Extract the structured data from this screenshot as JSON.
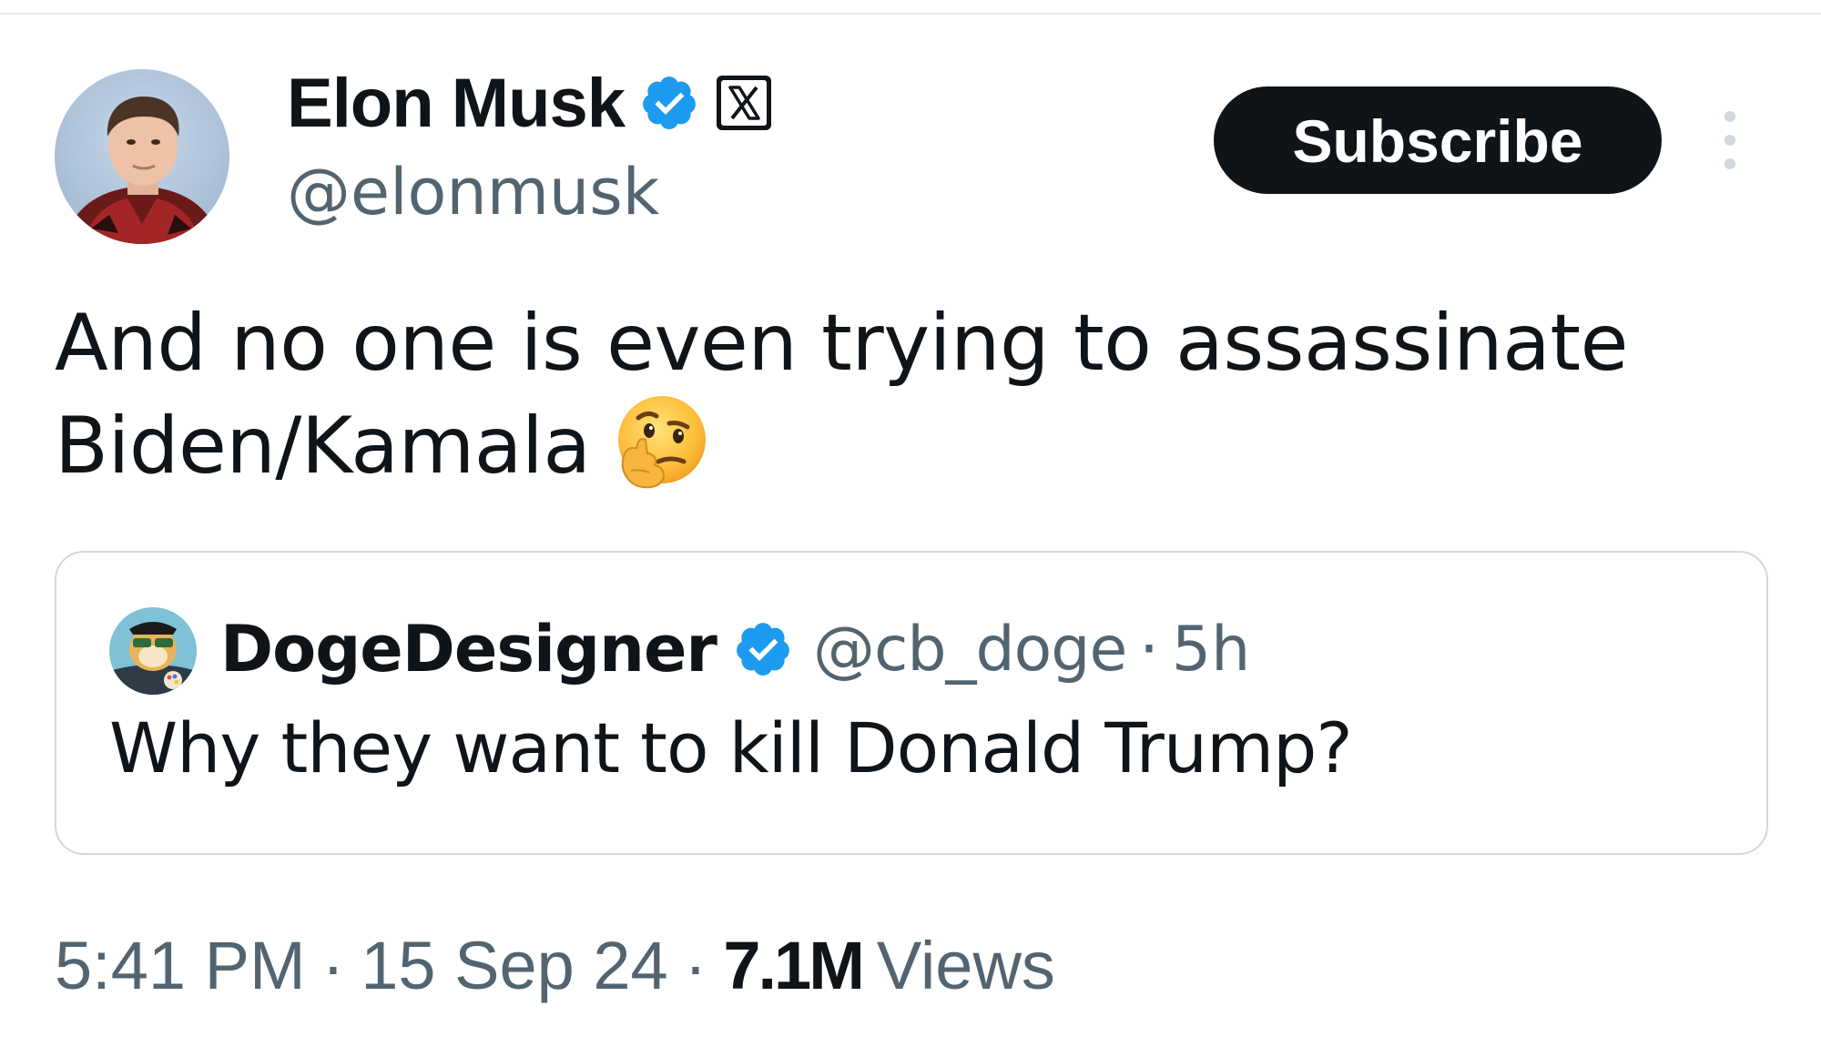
{
  "tweet": {
    "author": {
      "display_name": "Elon Musk",
      "handle": "@elonmusk",
      "verified": true,
      "affiliate_badge_icon": "x-logo-icon"
    },
    "subscribe_label": "Subscribe",
    "text_lines": [
      "And no one is even trying to assassinate",
      "Biden/Kamala"
    ],
    "emoji": "thinking-face-icon",
    "quoted_tweet": {
      "display_name": "DogeDesigner",
      "handle": "@cb_doge",
      "separator": "·",
      "time_ago": "5h",
      "verified": true,
      "text": "Why they want to kill Donald Trump?"
    },
    "meta": {
      "time": "5:41 PM",
      "separator": "·",
      "date": "15 Sep 24",
      "views_count": "7.1M",
      "views_label": "Views"
    }
  },
  "colors": {
    "text_primary": "#0f1419",
    "text_secondary": "#536471",
    "verified_blue": "#1d9bf0",
    "border": "#cfd9de",
    "button_bg": "#0f1419"
  }
}
